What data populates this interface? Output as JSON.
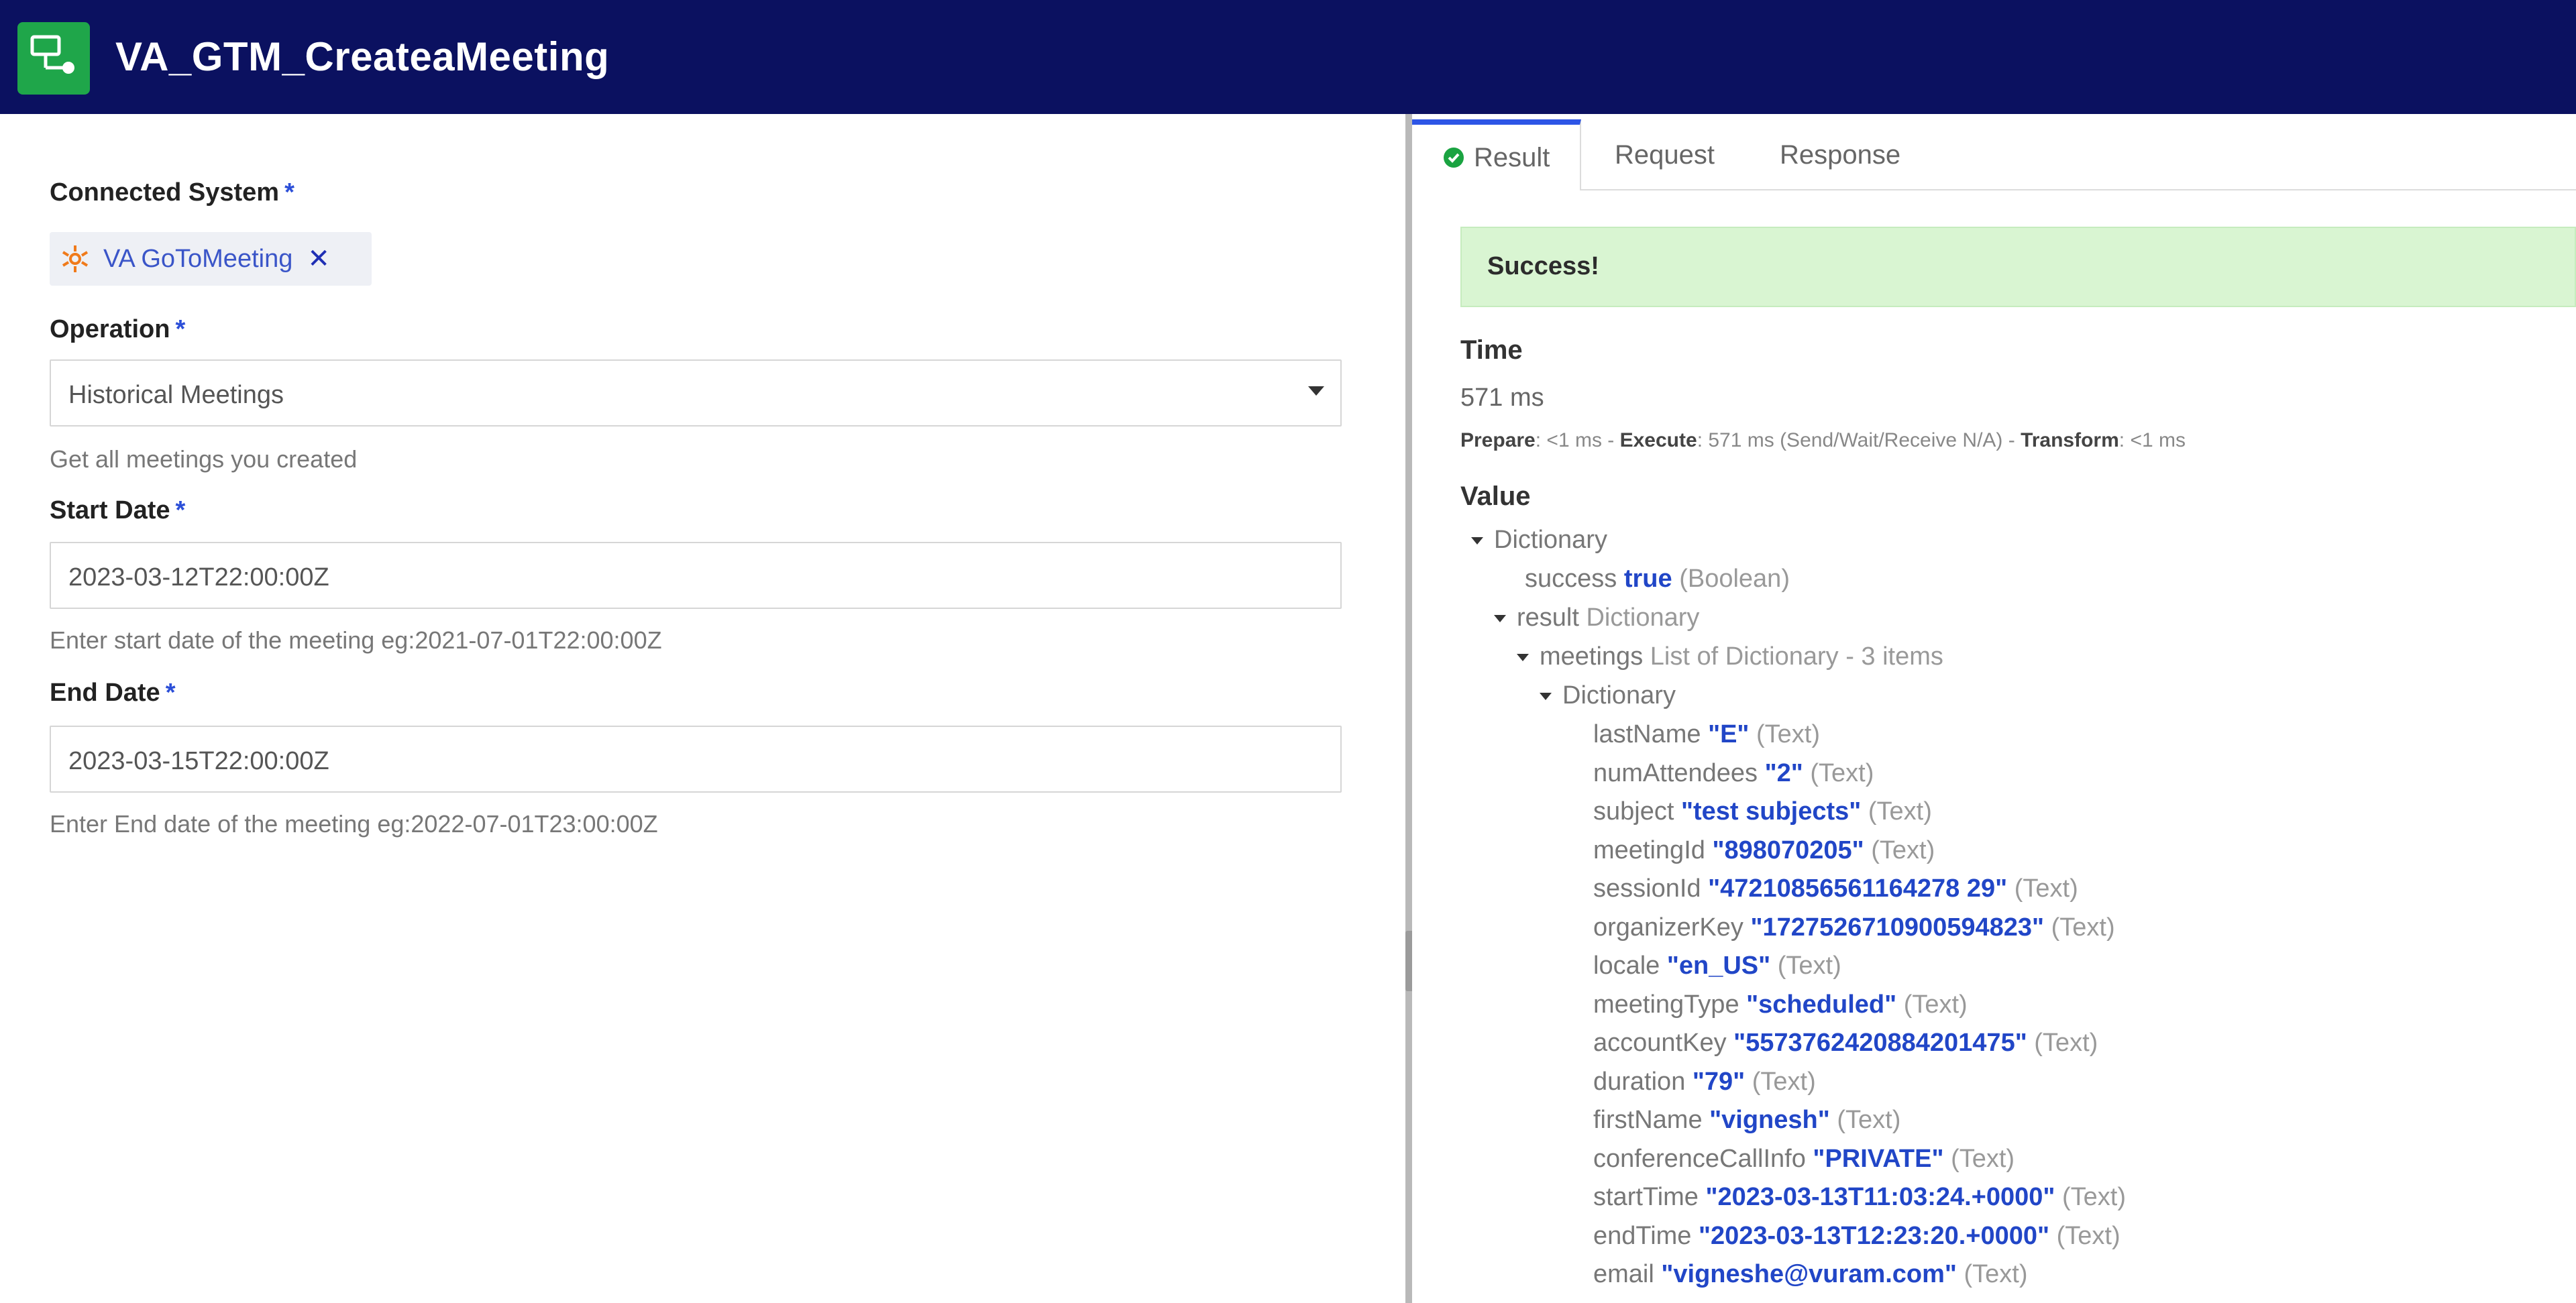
{
  "header": {
    "title": "VA_GTM_CreateaMeeting",
    "icon": "integration-icon",
    "bg_color": "#0b1160",
    "icon_color": "#1fa64a"
  },
  "form": {
    "connected_system": {
      "label": "Connected System",
      "required_mark": "*",
      "chip_label": "VA GoToMeeting",
      "remove_glyph": "✕"
    },
    "operation": {
      "label": "Operation",
      "required_mark": "*",
      "value": "Historical Meetings",
      "help": "Get all meetings you created"
    },
    "start_date": {
      "label": "Start Date",
      "required_mark": "*",
      "value": "2023-03-12T22:00:00Z",
      "help": "Enter start date of the meeting eg:2021-07-01T22:00:00Z"
    },
    "end_date": {
      "label": "End Date",
      "required_mark": "*",
      "value": "2023-03-15T22:00:00Z",
      "help": "Enter End date of the meeting eg:2022-07-01T23:00:00Z"
    }
  },
  "result_panel": {
    "tabs": [
      "Result",
      "Request",
      "Response"
    ],
    "active_tab": "Result",
    "success_message": "Success!",
    "time": {
      "label": "Time",
      "value": "571 ms",
      "prepare_label": "Prepare",
      "prepare_value": ": <1 ms - ",
      "execute_label": "Execute",
      "execute_value": ": 571 ms (Send/Wait/Receive N/A) - ",
      "transform_label": "Transform",
      "transform_value": ": <1 ms"
    },
    "value_label": "Value",
    "tree": {
      "root": "Dictionary",
      "success": {
        "key": "success",
        "value": "true",
        "type": "(Boolean)"
      },
      "result": {
        "key": "result",
        "type": "Dictionary"
      },
      "meetings": {
        "key": "meetings",
        "type": "List of Dictionary - 3 items"
      },
      "item": "Dictionary",
      "fields": [
        {
          "key": "lastName",
          "value": "\"E\"",
          "type": "(Text)"
        },
        {
          "key": "numAttendees",
          "value": "\"2\"",
          "type": "(Text)"
        },
        {
          "key": "subject",
          "value": "\"test subjects\"",
          "type": "(Text)"
        },
        {
          "key": "meetingId",
          "value": "\"898070205\"",
          "type": "(Text)"
        },
        {
          "key": "sessionId",
          "value": "\"47210856561164278 29\"",
          "type": "(Text)"
        },
        {
          "key": "organizerKey",
          "value": "\"1727526710900594823\"",
          "type": "(Text)"
        },
        {
          "key": "locale",
          "value": "\"en_US\"",
          "type": "(Text)"
        },
        {
          "key": "meetingType",
          "value": "\"scheduled\"",
          "type": "(Text)"
        },
        {
          "key": "accountKey",
          "value": "\"5573762420884201475\"",
          "type": "(Text)"
        },
        {
          "key": "duration",
          "value": "\"79\"",
          "type": "(Text)"
        },
        {
          "key": "firstName",
          "value": "\"vignesh\"",
          "type": "(Text)"
        },
        {
          "key": "conferenceCallInfo",
          "value": "\"PRIVATE\"",
          "type": "(Text)"
        },
        {
          "key": "startTime",
          "value": "\"2023-03-13T11:03:24.+0000\"",
          "type": "(Text)"
        },
        {
          "key": "endTime",
          "value": "\"2023-03-13T12:23:20.+0000\"",
          "type": "(Text)"
        },
        {
          "key": "email",
          "value": "\"vigneshe@vuram.com\"",
          "type": "(Text)"
        }
      ]
    }
  }
}
